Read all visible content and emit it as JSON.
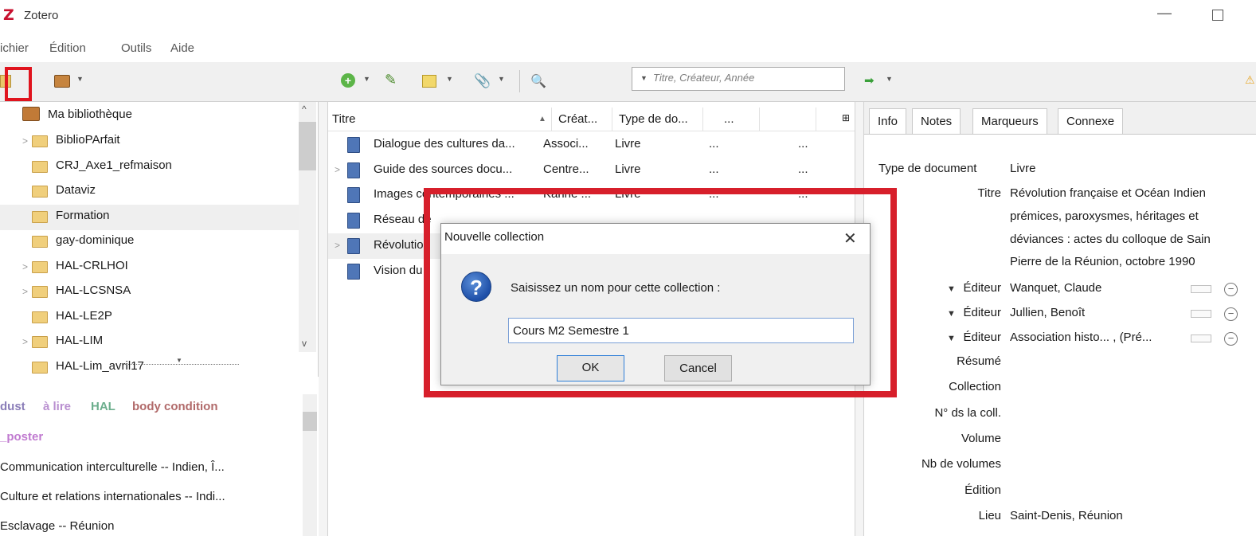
{
  "window": {
    "title": "Zotero",
    "logo_letter": "Z"
  },
  "menu": [
    "ichier",
    "Édition",
    "Outils",
    "Aide"
  ],
  "search": {
    "placeholder": "Titre, Créateur, Année"
  },
  "collections": {
    "root": "Ma bibliothèque",
    "items": [
      {
        "label": "BiblioPArfait",
        "expandable": true
      },
      {
        "label": "CRJ_Axe1_refmaison",
        "expandable": false
      },
      {
        "label": "Dataviz",
        "expandable": false
      },
      {
        "label": "Formation",
        "expandable": false,
        "selected": true
      },
      {
        "label": "gay-dominique",
        "expandable": false
      },
      {
        "label": "HAL-CRLHOI",
        "expandable": true
      },
      {
        "label": "HAL-LCSNSA",
        "expandable": true
      },
      {
        "label": "HAL-LE2P",
        "expandable": false
      },
      {
        "label": "HAL-LIM",
        "expandable": true
      },
      {
        "label": "HAL-Lim_avril17",
        "expandable": false
      }
    ]
  },
  "tags": {
    "colored": [
      {
        "label": "dust",
        "color": "#8a7db8"
      },
      {
        "label": "à lire",
        "color": "#b98fd0"
      },
      {
        "label": "HAL",
        "color": "#6cae8d"
      },
      {
        "label": "body condition",
        "color": "#b16a6a"
      }
    ],
    "poster": {
      "label": "_poster",
      "color": "#c07ad0"
    },
    "list": [
      "Communication interculturelle -- Indien, Î...",
      "Culture et relations internationales -- Indi...",
      "Esclavage -- Réunion"
    ]
  },
  "items": {
    "columns": [
      "Titre",
      "Créat...",
      "Type de do...",
      "..."
    ],
    "rows": [
      {
        "title": "Dialogue des cultures da...",
        "creator": "Associ...",
        "type": "Livre",
        "c4": "...",
        "c5": "...",
        "twisty": false
      },
      {
        "title": "Guide des sources docu...",
        "creator": "Centre...",
        "type": "Livre",
        "c4": "...",
        "c5": "...",
        "twisty": true
      },
      {
        "title": "Images contemporaines ...",
        "creator": "Karine ...",
        "type": "Livre",
        "c4": "...",
        "c5": "...",
        "twisty": false
      },
      {
        "title": "Réseau de",
        "creator": "",
        "type": "",
        "c4": "",
        "c5": "",
        "twisty": false
      },
      {
        "title": "Révolution",
        "creator": "",
        "type": "",
        "c4": "",
        "c5": "",
        "twisty": true,
        "selected": true
      },
      {
        "title": "Vision du",
        "creator": "",
        "type": "",
        "c4": "",
        "c5": "",
        "twisty": false
      }
    ]
  },
  "details": {
    "tabs": [
      "Info",
      "Notes",
      "Marqueurs",
      "Connexe"
    ],
    "type_label": "Type de document",
    "type_value": "Livre",
    "title_label": "Titre",
    "title_lines": [
      "Révolution française et Océan Indien",
      "prémices, paroxysmes, héritages et",
      "déviances : actes du colloque de Sain",
      "Pierre de la Réunion, octobre 1990"
    ],
    "creators": [
      {
        "role": "Éditeur",
        "name": "Wanquet, Claude"
      },
      {
        "role": "Éditeur",
        "name": "Jullien, Benoît"
      },
      {
        "role": "Éditeur",
        "name": "Association histo... , (Pré..."
      }
    ],
    "fields": [
      {
        "label": "Résumé",
        "value": ""
      },
      {
        "label": "Collection",
        "value": ""
      },
      {
        "label": "N° ds la coll.",
        "value": ""
      },
      {
        "label": "Volume",
        "value": ""
      },
      {
        "label": "Nb de volumes",
        "value": ""
      },
      {
        "label": "Édition",
        "value": ""
      },
      {
        "label": "Lieu",
        "value": "Saint-Denis, Réunion"
      }
    ]
  },
  "dialog": {
    "title": "Nouvelle collection",
    "prompt": "Saisissez un nom pour cette collection :",
    "input_value": "Cours M2 Semestre 1",
    "ok": "OK",
    "cancel": "Cancel"
  },
  "colors": {
    "highlight": "#e0141e",
    "selection": "#efefef"
  }
}
